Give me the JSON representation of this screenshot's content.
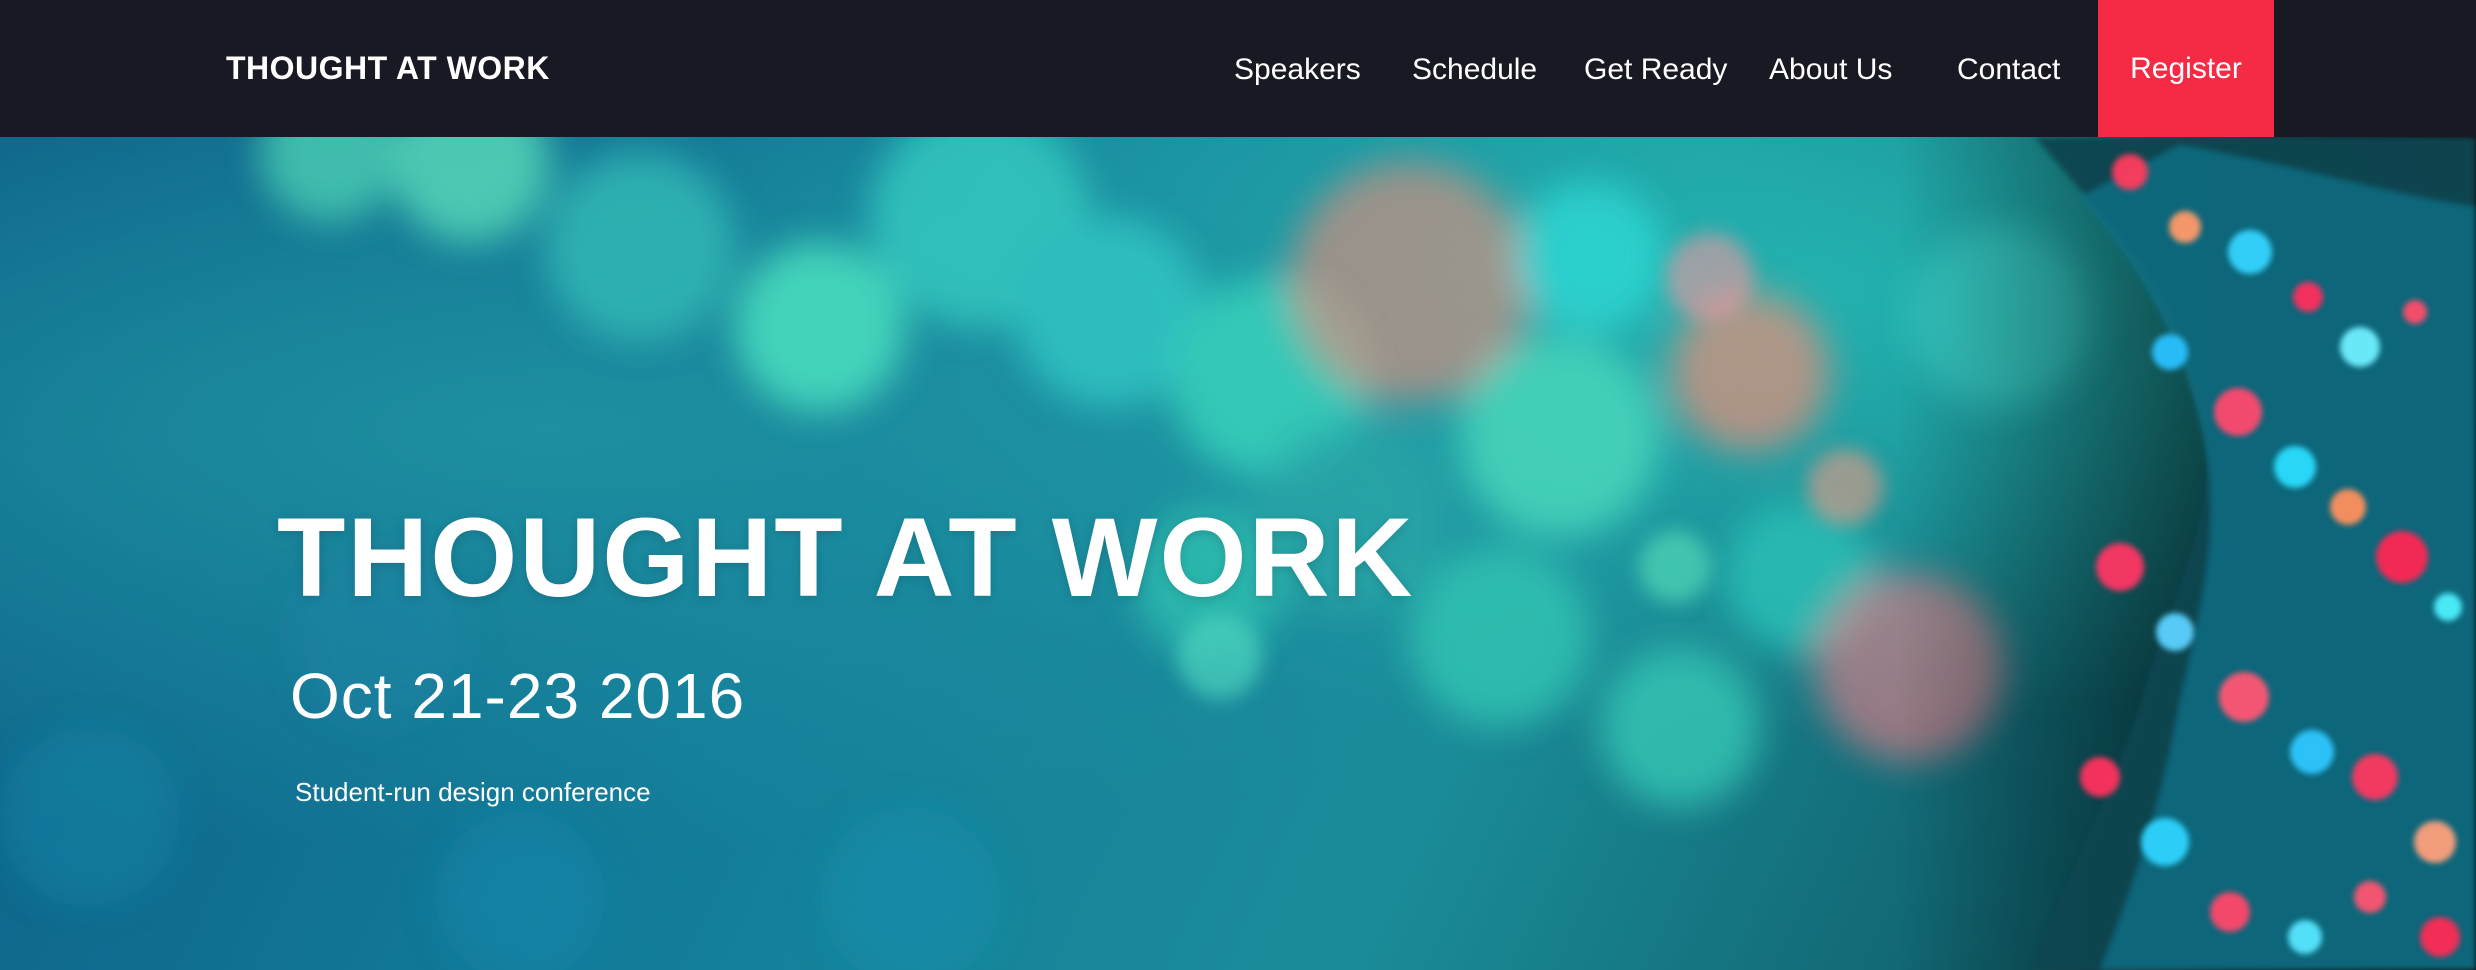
{
  "colors": {
    "nav_background": "#181922",
    "register_background": "#f52a45",
    "text": "#ffffff"
  },
  "nav": {
    "brand": "THOUGHT AT WORK",
    "links": [
      {
        "label": "Speakers"
      },
      {
        "label": "Schedule"
      },
      {
        "label": "Get Ready"
      },
      {
        "label": "About Us"
      },
      {
        "label": "Contact"
      }
    ],
    "register_label": "Register"
  },
  "hero": {
    "title": "THOUGHT AT WORK",
    "date": "Oct 21-23 2016",
    "tagline": "Student-run design conference"
  }
}
